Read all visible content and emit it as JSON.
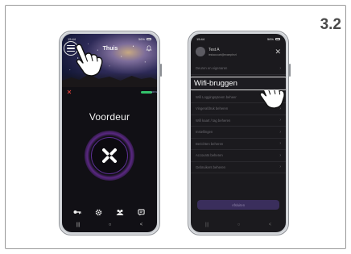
{
  "step_number": "3.2",
  "phone_left": {
    "status_time": "15:44",
    "status_right": "56%",
    "header_title": "Thuis",
    "battery_label": "100%",
    "door_name": "Voordeur",
    "nav_icons": [
      "key-icon",
      "gear-icon",
      "people-icon",
      "chat-icon"
    ],
    "sys_nav": [
      "|||",
      "○",
      "<"
    ]
  },
  "phone_right": {
    "status_time": "15:44",
    "status_right": "56%",
    "user_name": "Test A",
    "user_email": "testaccount@example.nl",
    "menu_items": [
      "Deuren en eigenaren",
      "Wifi-bruggen",
      "Wifi Loggingsyteem beheer",
      "Vingerafdruk beheren",
      "Wifi kaart / tag beheren",
      "Instellingen",
      "Berichten beheren",
      "Accounts beheren",
      "Gebruikers beheren"
    ],
    "highlight_index": 1,
    "cta_label": "Afsluiten",
    "sys_nav": [
      "|||",
      "○",
      "<"
    ]
  },
  "colors": {
    "accent_purple": "#7a3fd0",
    "battery_green": "#33c26b",
    "no_signal_red": "#d9403a"
  }
}
